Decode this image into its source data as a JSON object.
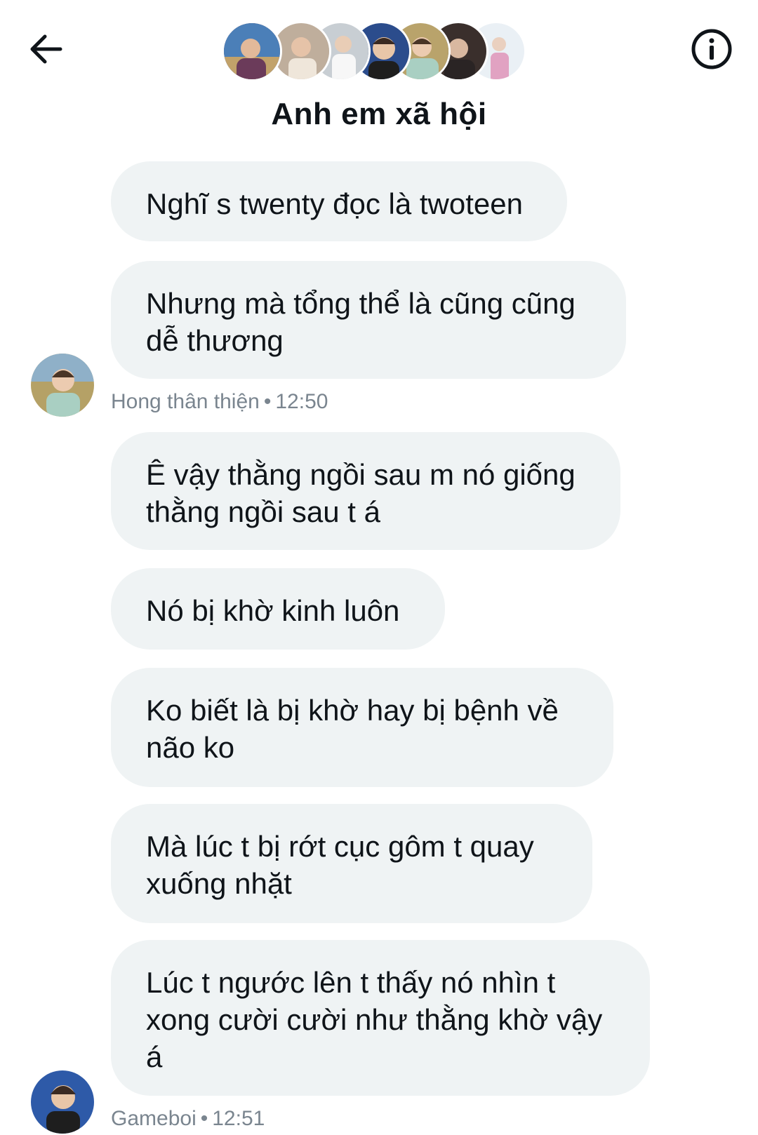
{
  "header": {
    "title": "Anh em xã hội",
    "back_icon": "arrow-left-icon",
    "info_icon": "info-circle-icon",
    "member_avatars": [
      {
        "bg": "#6b4a5e",
        "accent": "#c9a27e"
      },
      {
        "bg": "#8a6f5a",
        "accent": "#e8d8c8"
      },
      {
        "bg": "#9aa4ad",
        "accent": "#f2f2f2"
      },
      {
        "bg": "#2b4c8c",
        "accent": "#d9b99a"
      },
      {
        "bg": "#b7a46a",
        "accent": "#9fc7b9"
      },
      {
        "bg": "#3a2f2c",
        "accent": "#cfb5a2"
      },
      {
        "bg": "#e7d6e0",
        "accent": "#d88bb0"
      }
    ]
  },
  "messages": [
    {
      "text": "Nghĩ s twenty đọc là twoteen"
    },
    {
      "text": "Nhưng mà tổng thể là cũng cũng\ndễ thương"
    },
    {
      "sender": "Hong thân thiện",
      "time": "12:50"
    },
    {
      "text": "Ê vậy thằng ngồi sau m nó giống\nthằng ngồi sau t á"
    },
    {
      "text": "Nó bị khờ kinh luôn"
    },
    {
      "text": "Ko biết là bị khờ hay bị bệnh về\nnão ko"
    },
    {
      "text": "Mà lúc t bị rớt cục gôm t quay\nxuống nhặt"
    },
    {
      "text": "Lúc t ngước lên t thấy nó nhìn t\nxong cười cười như thằng khờ vậy\ná"
    },
    {
      "sender": "Gameboi",
      "time": "12:51"
    }
  ],
  "colors": {
    "bubble_bg": "#eff3f4",
    "text": "#0f1419",
    "meta_text": "#7a858f"
  }
}
